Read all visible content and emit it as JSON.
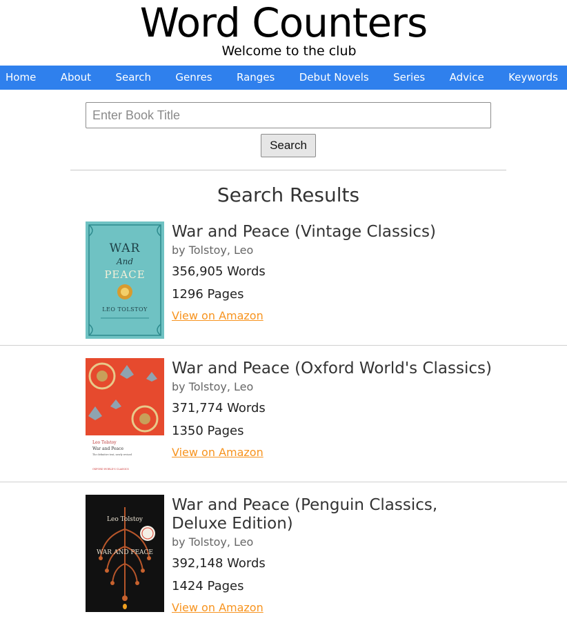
{
  "header": {
    "site_title": "Word Counters",
    "tagline": "Welcome to the club"
  },
  "nav": {
    "items": [
      "Home",
      "About",
      "Search",
      "Genres",
      "Ranges",
      "Debut Novels",
      "Series",
      "Advice",
      "Keywords"
    ]
  },
  "search": {
    "placeholder": "Enter Book Title",
    "value": "",
    "button_label": "Search"
  },
  "results": {
    "heading": "Search Results",
    "items": [
      {
        "title": "War and Peace (Vintage Classics)",
        "author": "by Tolstoy, Leo",
        "words": "356,905 Words",
        "pages": "1296 Pages",
        "link": "View on Amazon",
        "cover": {
          "line1": "WAR",
          "line2": "And",
          "line3": "PEACE",
          "author": "LEO TOLSTOY",
          "bg": "#6fc2c3"
        }
      },
      {
        "title": "War and Peace (Oxford World's Classics)",
        "author": "by Tolstoy, Leo",
        "words": "371,774 Words",
        "pages": "1350 Pages",
        "link": "View on Amazon",
        "cover": {
          "author": "Leo Tolstoy",
          "title": "War and Peace",
          "subtitle": "The definitive text, newly revised",
          "series": "OXFORD WORLD'S CLASSICS",
          "bg": "#e64a2e"
        }
      },
      {
        "title": "War and Peace (Penguin Classics, Deluxe Edition)",
        "author": "by Tolstoy, Leo",
        "words": "392,148 Words",
        "pages": "1424 Pages",
        "link": "View on Amazon",
        "cover": {
          "author": "Leo Tolstoy",
          "title": "WAR AND PEACE",
          "bg": "#111111"
        }
      }
    ]
  },
  "colors": {
    "nav_bg": "#2f80ed",
    "link": "#f7931e"
  }
}
